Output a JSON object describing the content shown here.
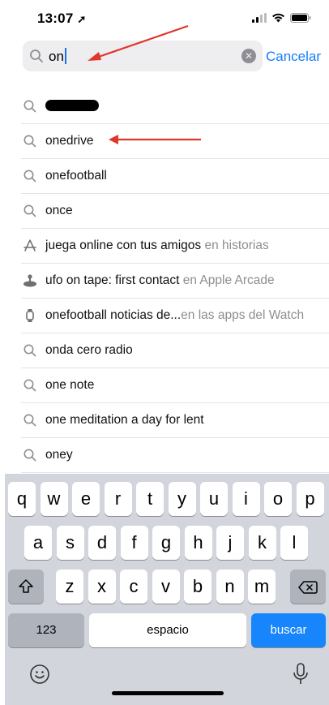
{
  "status": {
    "time": "13:07"
  },
  "search": {
    "query": "on",
    "cancel_label": "Cancelar"
  },
  "suggestions": [
    {
      "text": "",
      "sub": "",
      "icon": "search-icon",
      "redacted": true
    },
    {
      "text": "onedrive",
      "sub": "",
      "icon": "search-icon"
    },
    {
      "text": "onefootball",
      "sub": "",
      "icon": "search-icon"
    },
    {
      "text": "once",
      "sub": "",
      "icon": "search-icon"
    },
    {
      "text": "juega online con tus amigos",
      "sub": " en historias",
      "icon": "appstore-icon"
    },
    {
      "text": "ufo on tape: first contact",
      "sub": " en Apple Arcade",
      "icon": "arcade-icon"
    },
    {
      "text": "onefootball noticias de...",
      "sub": "en las apps del Watch",
      "icon": "watch-icon"
    },
    {
      "text": "onda cero radio",
      "sub": "",
      "icon": "search-icon"
    },
    {
      "text": "one note",
      "sub": "",
      "icon": "search-icon"
    },
    {
      "text": "one meditation a day for lent",
      "sub": "",
      "icon": "search-icon"
    },
    {
      "text": "oney",
      "sub": "",
      "icon": "search-icon"
    }
  ],
  "keyboard": {
    "row1": [
      "q",
      "w",
      "e",
      "r",
      "t",
      "y",
      "u",
      "i",
      "o",
      "p"
    ],
    "row2": [
      "a",
      "s",
      "d",
      "f",
      "g",
      "h",
      "j",
      "k",
      "l"
    ],
    "row3": [
      "z",
      "x",
      "c",
      "v",
      "b",
      "n",
      "m"
    ],
    "numbers_label": "123",
    "space_label": "espacio",
    "return_label": "buscar"
  },
  "colors": {
    "accent": "#147efb",
    "annotation_arrow": "#e0362c",
    "return_key": "#1785fb"
  }
}
